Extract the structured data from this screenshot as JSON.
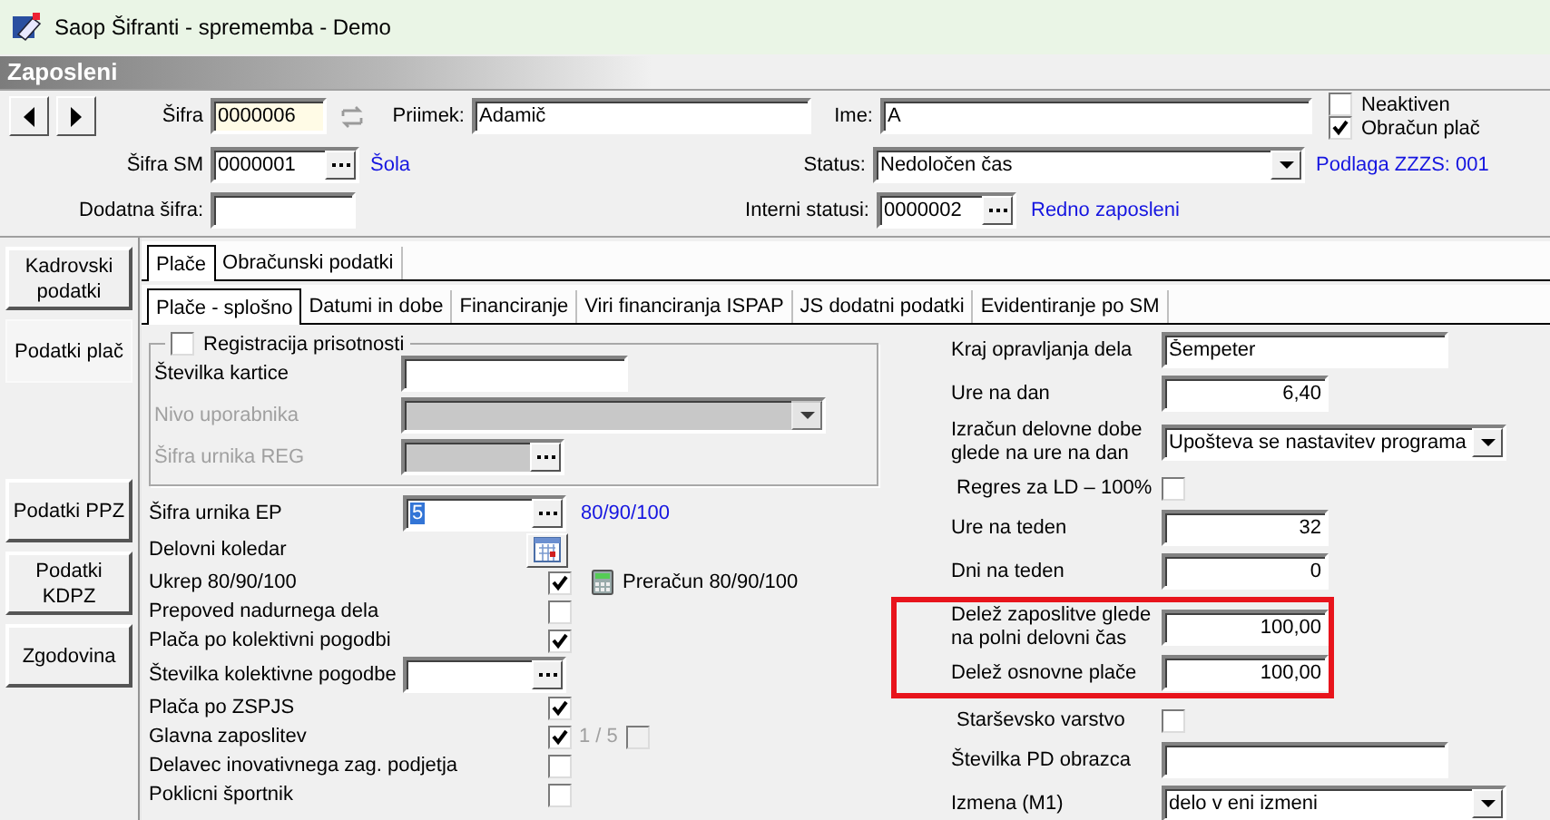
{
  "window": {
    "title": "Saop Šifranti - sprememba - Demo"
  },
  "section_title": "Zaposleni",
  "header": {
    "sifra": {
      "label": "Šifra",
      "value": "0000006"
    },
    "priimek": {
      "label": "Priimek:",
      "value": "Adamič"
    },
    "ime": {
      "label": "Ime:",
      "value": "A"
    },
    "flags": [
      {
        "label": "Neaktiven",
        "checked": false
      },
      {
        "label": "Obračun plač",
        "checked": true
      }
    ],
    "sifra_sm": {
      "label": "Šifra SM",
      "value": "0000001",
      "link": "Šola"
    },
    "status": {
      "label": "Status:",
      "value": "Nedoločen čas"
    },
    "podlaga": "Podlaga ZZZS: 001",
    "dodatna_sifra": {
      "label": "Dodatna šifra:"
    },
    "interni_statusi": {
      "label": "Interni statusi:",
      "value": "0000002",
      "link": "Redno zaposleni"
    }
  },
  "sidebar": {
    "top": [
      {
        "label": "Kadrovski podatki",
        "selected": false
      },
      {
        "label": "Podatki plač",
        "selected": true
      }
    ],
    "bottom": [
      {
        "label": "Podatki PPZ",
        "selected": false
      },
      {
        "label": "Podatki KDPZ",
        "selected": false
      },
      {
        "label": "Zgodovina",
        "selected": false
      }
    ]
  },
  "tabs": [
    {
      "label": "Plače",
      "selected": true
    },
    {
      "label": "Obračunski podatki",
      "selected": false
    }
  ],
  "subtabs": [
    {
      "label": "Plače - splošno",
      "selected": true
    },
    {
      "label": "Datumi in dobe",
      "selected": false
    },
    {
      "label": "Financiranje",
      "selected": false
    },
    {
      "label": "Viri financiranja ISPAP",
      "selected": false
    },
    {
      "label": "JS dodatni podatki",
      "selected": false
    },
    {
      "label": "Evidentiranje po SM",
      "selected": false
    }
  ],
  "registration": {
    "label": "Registracija prisotnosti",
    "checked": false,
    "rows": [
      {
        "label": "Številka kartice",
        "kind": "text",
        "disabled": false
      },
      {
        "label": "Nivo uporabnika",
        "kind": "combo",
        "disabled": true
      },
      {
        "label": "Šifra urnika REG",
        "kind": "lookup",
        "disabled": true
      }
    ]
  },
  "left_rows": [
    {
      "label": "Šifra urnika EP",
      "kind": "lookup",
      "value": "5",
      "text_selected": true,
      "link": "80/90/100"
    },
    {
      "label": "Delovni koledar",
      "kind": "calendar"
    },
    {
      "label": "Ukrep 80/90/100",
      "kind": "check",
      "checked": true,
      "action": "Preračun 80/90/100"
    },
    {
      "label": "Prepoved nadurnega dela",
      "kind": "check",
      "checked": false
    },
    {
      "label": "Plača po kolektivni pogodbi",
      "kind": "check",
      "checked": true
    },
    {
      "label": "Številka kolektivne pogodbe",
      "kind": "lookup"
    },
    {
      "label": "Plača po ZSPJS",
      "kind": "check",
      "checked": true
    },
    {
      "label": "Glavna zaposlitev",
      "kind": "check",
      "checked": true,
      "counter": "1 / 5",
      "counter_checked": false
    },
    {
      "label": "Delavec inovativnega zag. podjetja",
      "kind": "check",
      "checked": false
    },
    {
      "label": "Poklicni športnik",
      "kind": "check",
      "checked": false
    }
  ],
  "right_rows": [
    {
      "label": "Kraj opravljanja dela",
      "kind": "text",
      "value": "Šempeter"
    },
    {
      "label": "Ure na dan",
      "kind": "number",
      "value": "6,40"
    },
    {
      "label": "Izračun delovne dobe glede na ure na dan",
      "kind": "combo",
      "value": "Upošteva se nastavitev programa"
    },
    {
      "label": "Regres za LD – 100%",
      "kind": "check",
      "checked": false
    },
    {
      "label": "Ure na teden",
      "kind": "number",
      "value": "32"
    },
    {
      "label": "Dni na teden",
      "kind": "number",
      "value": "0"
    },
    {
      "kind": "highlight",
      "rows": [
        {
          "label": "Delež zaposlitve glede na polni delovni čas",
          "kind": "number",
          "value": "100,00"
        },
        {
          "label": "Delež osnovne plače",
          "kind": "number",
          "value": "100,00"
        }
      ]
    },
    {
      "label": "Starševsko varstvo",
      "kind": "check",
      "checked": false
    },
    {
      "label": "Številka PD obrazca",
      "kind": "text"
    },
    {
      "label": "Izmena (M1)",
      "kind": "combo",
      "value": "delo v eni izmeni"
    }
  ]
}
